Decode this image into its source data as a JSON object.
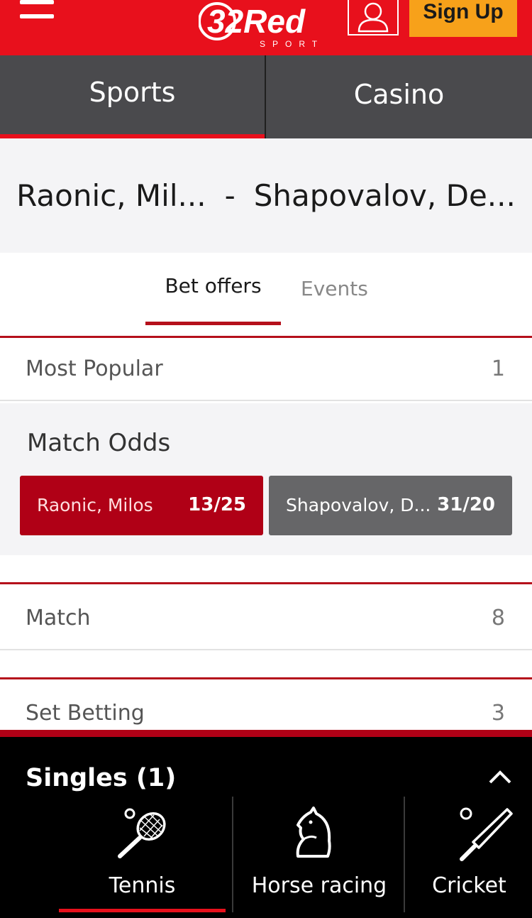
{
  "header": {
    "logo_text": "32Red",
    "logo_sub": "SPORT",
    "signup_label": "Sign Up"
  },
  "main_tabs": [
    {
      "label": "Sports",
      "active": true
    },
    {
      "label": "Casino",
      "active": false
    }
  ],
  "match": {
    "home": "Raonic, Mil...",
    "separator": "-",
    "away": "Shapovalov, De..."
  },
  "sub_tabs": [
    {
      "label": "Bet offers",
      "active": true
    },
    {
      "label": "Events",
      "active": false
    }
  ],
  "sections": [
    {
      "title": "Most Popular",
      "count": "1"
    },
    {
      "title": "Match",
      "count": "8"
    },
    {
      "title": "Set Betting",
      "count": "3"
    }
  ],
  "match_odds": {
    "heading": "Match Odds",
    "outcomes": [
      {
        "name": "Raonic, Milos",
        "price": "13/25",
        "selected": true
      },
      {
        "name": "Shapovalov, D...",
        "price": "31/20",
        "selected": false
      }
    ]
  },
  "betslip": {
    "title": "Singles (1)"
  },
  "sport_nav": [
    {
      "label": "Tennis",
      "icon": "tennis-racket-icon",
      "active": true
    },
    {
      "label": "Horse racing",
      "icon": "horse-head-icon",
      "active": false
    },
    {
      "label": "Cricket",
      "icon": "cricket-bat-icon",
      "active": false
    }
  ],
  "colors": {
    "brand_red": "#e8101c",
    "dark_red": "#b00016",
    "signup_orange": "#f7a11a",
    "tab_grey": "#4a4a4d"
  }
}
